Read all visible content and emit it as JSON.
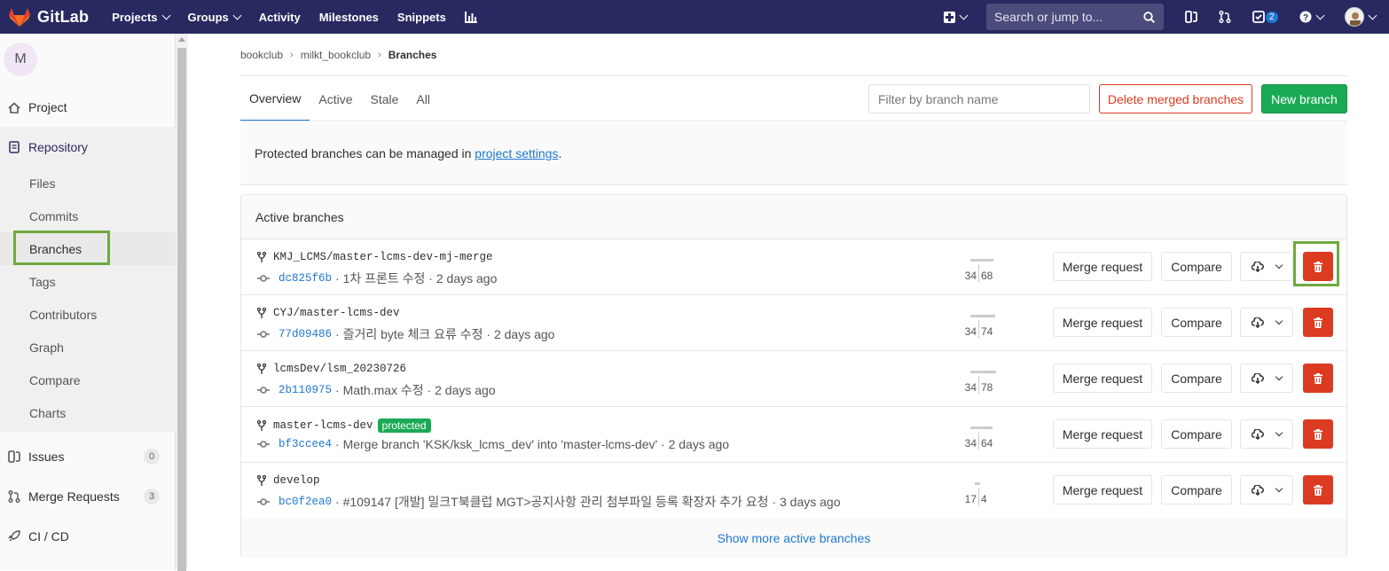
{
  "navbar": {
    "brand": "GitLab",
    "links": [
      {
        "label": "Projects",
        "dropdown": true
      },
      {
        "label": "Groups",
        "dropdown": true
      },
      {
        "label": "Activity",
        "dropdown": false
      },
      {
        "label": "Milestones",
        "dropdown": false
      },
      {
        "label": "Snippets",
        "dropdown": false
      }
    ],
    "search_placeholder": "Search or jump to...",
    "todo_count": "2"
  },
  "sidebar": {
    "project_initial": "M",
    "project": "Project",
    "repository": "Repository",
    "repo_items": [
      "Files",
      "Commits",
      "Branches",
      "Tags",
      "Contributors",
      "Graph",
      "Compare",
      "Charts"
    ],
    "issues": {
      "label": "Issues",
      "count": "0"
    },
    "merge_requests": {
      "label": "Merge Requests",
      "count": "3"
    },
    "cicd": "CI / CD"
  },
  "breadcrumb": [
    "bookclub",
    "milkt_bookclub",
    "Branches"
  ],
  "tabs": [
    "Overview",
    "Active",
    "Stale",
    "All"
  ],
  "filter_placeholder": "Filter by branch name",
  "buttons": {
    "delete_merged": "Delete merged branches",
    "new_branch": "New branch",
    "merge_request": "Merge request",
    "compare": "Compare"
  },
  "info": {
    "text_before": "Protected branches can be managed in ",
    "link": "project settings",
    "text_after": "."
  },
  "panel_title": "Active branches",
  "branches": [
    {
      "name": "KMJ_LCMS/master-lcms-dev-mj-merge",
      "protected": false,
      "sha": "dc825f6b",
      "message": "· 1차 프론트 수정 · 2 days ago",
      "behind": "34",
      "ahead": "68"
    },
    {
      "name": "CYJ/master-lcms-dev",
      "protected": false,
      "sha": "77d09486",
      "message": "· 즐거리 byte 체크 요류 수정 · 2 days ago",
      "behind": "34",
      "ahead": "74"
    },
    {
      "name": "lcmsDev/lsm_20230726",
      "protected": false,
      "sha": "2b110975",
      "message": "· Math.max 수정 · 2 days ago",
      "behind": "34",
      "ahead": "78"
    },
    {
      "name": "master-lcms-dev",
      "protected": true,
      "protected_label": "protected",
      "sha": "bf3ccee4",
      "message": "· Merge branch 'KSK/ksk_lcms_dev' into 'master-lcms-dev' · 2 days ago",
      "behind": "34",
      "ahead": "64"
    },
    {
      "name": "develop",
      "protected": false,
      "sha": "bc0f2ea0",
      "message": "· #109147 [개발] 밀크T북클럽 MGT>공지사항 관리 첨부파일 등록 확장자 추가 요청 · 3 days ago",
      "behind": "17",
      "ahead": "4"
    }
  ],
  "show_more": "Show more active branches",
  "colors": {
    "navbar": "#292961",
    "accent": "#1f78d1",
    "danger": "#db3b21",
    "success": "#1aaa55",
    "highlight": "#6fa93f"
  }
}
